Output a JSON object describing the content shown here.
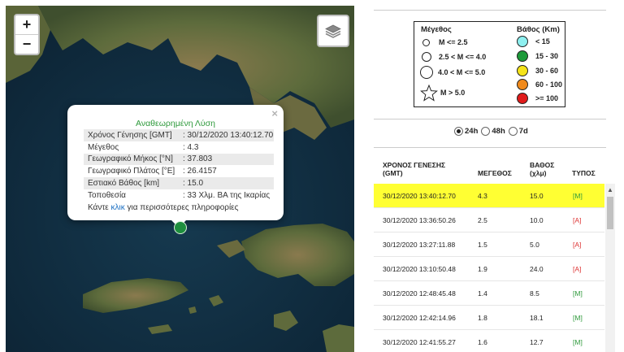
{
  "map": {
    "zoom_in_label": "+",
    "zoom_out_label": "−",
    "popup": {
      "close_label": "×",
      "title": "Αναθεωρημένη Λύση",
      "rows": [
        {
          "key": "Χρόνος Γένησης [GMT]",
          "value": ": 30/12/2020 13:40:12.70"
        },
        {
          "key": "Μέγεθος",
          "value": ": 4.3"
        },
        {
          "key": "Γεωγραφικό Μήκος [°N]",
          "value": ": 37.803"
        },
        {
          "key": "Γεωγραφικό Πλάτος [°E]",
          "value": ": 26.4157"
        },
        {
          "key": "Εστιακό Βάθος [km]",
          "value": ": 15.0"
        },
        {
          "key": "Τοποθεσία",
          "value": ": 33 Χλμ. ΒΑ της Ικαρίας"
        }
      ],
      "more_prefix": "Κάντε ",
      "more_link": "κλικ",
      "more_suffix": " για περισσότερες πληροφορίες"
    },
    "marker_color": "#1e8e3e"
  },
  "legend": {
    "magnitude_title": "Μέγεθος",
    "magnitude_items": [
      "M <= 2.5",
      "2.5 < M <= 4.0",
      "4.0 < M <= 5.0",
      "M > 5.0"
    ],
    "depth_title": "Βάθος (Km)",
    "depth_items": [
      {
        "label": "< 15",
        "color": "#8ef0f0"
      },
      {
        "label": "15 - 30",
        "color": "#1e9a3a"
      },
      {
        "label": "30 - 60",
        "color": "#f5e31a"
      },
      {
        "label": "60 - 100",
        "color": "#f08a1c"
      },
      {
        "label": ">= 100",
        "color": "#e01b1b"
      }
    ]
  },
  "filter": {
    "options": [
      {
        "label": "24h",
        "selected": true
      },
      {
        "label": "48h",
        "selected": false
      },
      {
        "label": "7d",
        "selected": false
      }
    ]
  },
  "table": {
    "headers": {
      "time_line1": "ΧΡΟΝΟΣ ΓΕΝΕΣΗΣ",
      "time_line2": "(GMT)",
      "magnitude": "ΜΕΓΕΘΟΣ",
      "depth_line1": "ΒΑΘΟΣ",
      "depth_line2": "(χλμ)",
      "type": "ΤΥΠΟΣ"
    },
    "rows": [
      {
        "time": "30/12/2020 13:40:12.70",
        "mag": "4.3",
        "depth": "15.0",
        "type": "[M]",
        "highlight": true
      },
      {
        "time": "30/12/2020 13:36:50.26",
        "mag": "2.5",
        "depth": "10.0",
        "type": "[A]"
      },
      {
        "time": "30/12/2020 13:27:11.88",
        "mag": "1.5",
        "depth": "5.0",
        "type": "[A]"
      },
      {
        "time": "30/12/2020 13:10:50.48",
        "mag": "1.9",
        "depth": "24.0",
        "type": "[A]"
      },
      {
        "time": "30/12/2020 12:48:45.48",
        "mag": "1.4",
        "depth": "8.5",
        "type": "[M]"
      },
      {
        "time": "30/12/2020 12:42:14.96",
        "mag": "1.8",
        "depth": "18.1",
        "type": "[M]"
      },
      {
        "time": "30/12/2020 12:41:55.27",
        "mag": "1.6",
        "depth": "12.7",
        "type": "[M]"
      }
    ]
  }
}
